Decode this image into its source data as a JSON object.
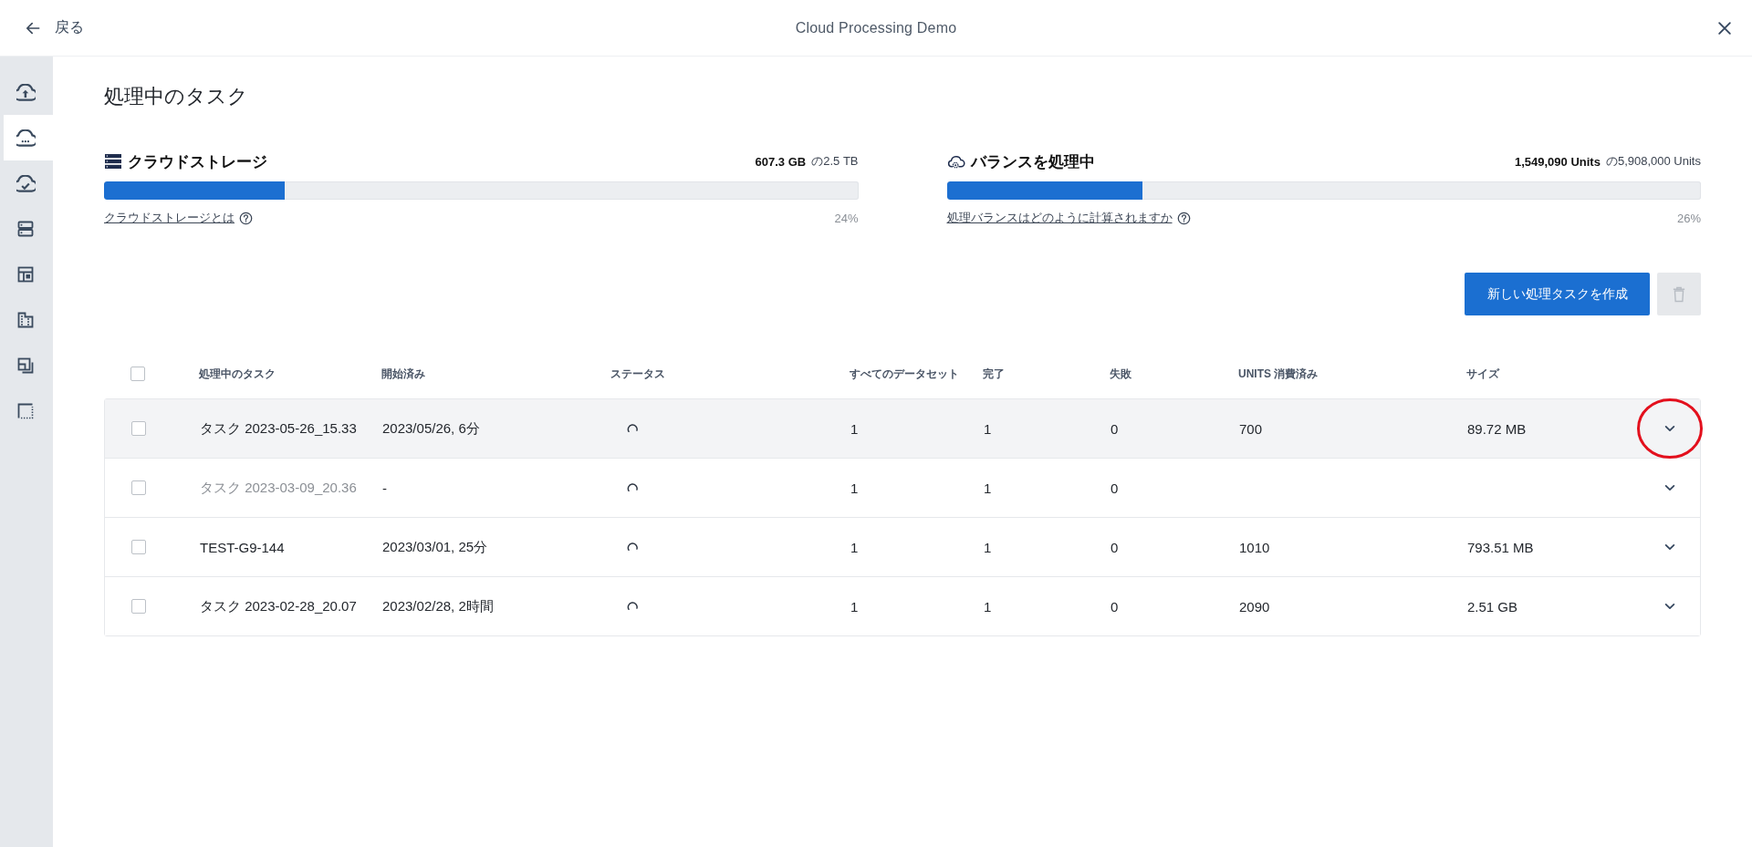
{
  "header": {
    "back_label": "戻る",
    "title": "Cloud Processing Demo"
  },
  "sidebar": {
    "items": [
      {
        "selected": false
      },
      {
        "selected": true
      },
      {
        "selected": false
      },
      {
        "selected": false
      },
      {
        "selected": false
      },
      {
        "selected": false
      },
      {
        "selected": false
      },
      {
        "selected": false
      }
    ]
  },
  "page_title": "処理中のタスク",
  "meters": [
    {
      "kind": "storage",
      "title": "クラウドストレージ",
      "used": "607.3 GB",
      "total": "の2.5 TB",
      "level": 0.24,
      "percent": "24%",
      "help_link": "クラウドストレージとは"
    },
    {
      "kind": "processing",
      "title": "バランスを処理中",
      "used": "1,549,090 Units",
      "total": "の5,908,000 Units",
      "level": 0.26,
      "percent": "26%",
      "help_link": "処理バランスはどのように計算されますか"
    }
  ],
  "actions": {
    "create_button": "新しい処理タスクを作成",
    "delete_disabled": true
  },
  "table": {
    "select_all_checked": false,
    "columns": [
      "処理中のタスク",
      "開始済み",
      "ステータス",
      "すべてのデータセット",
      "完了",
      "失敗",
      "UNITS 消費済み",
      "サイズ"
    ],
    "rows": [
      {
        "checked": false,
        "highlighted": true,
        "dimmed": false,
        "name": "タスク 2023-05-26_15.33",
        "started": "2023/05/26, 6分",
        "loading": true,
        "datasets": "1",
        "completed": "1",
        "failed": "0",
        "units": "700",
        "size": "89.72 MB",
        "expanded": false,
        "circled": true
      },
      {
        "checked": false,
        "highlighted": false,
        "dimmed": true,
        "name": "タスク 2023-03-09_20.36",
        "started": "-",
        "loading": true,
        "datasets": "1",
        "completed": "1",
        "failed": "0",
        "expanded": false,
        "circled": false
      },
      {
        "checked": false,
        "highlighted": false,
        "dimmed": false,
        "name": "TEST-G9-144",
        "started": "2023/03/01, 25分",
        "loading": true,
        "datasets": "1",
        "completed": "1",
        "failed": "0",
        "units": "1010",
        "size": "793.51 MB",
        "expanded": false,
        "circled": false
      },
      {
        "checked": false,
        "highlighted": false,
        "dimmed": false,
        "name": "タスク 2023-02-28_20.07",
        "started": "2023/02/28, 2時間",
        "loading": true,
        "datasets": "1",
        "completed": "1",
        "failed": "0",
        "units": "2090",
        "size": "2.51 GB",
        "expanded": false,
        "circled": false
      }
    ]
  }
}
